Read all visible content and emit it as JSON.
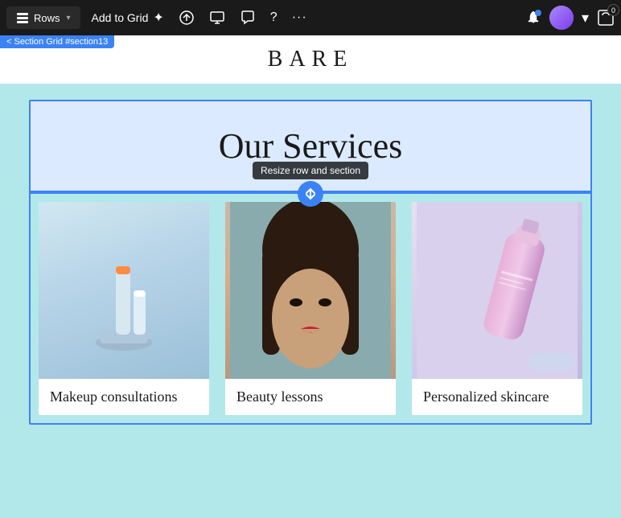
{
  "toolbar": {
    "rows_label": "Rows",
    "add_to_grid_label": "Add to Grid",
    "icons": {
      "sparkle": "✦",
      "move_up": "⬆",
      "desktop": "🖥",
      "comment": "💬",
      "help": "?",
      "more": "···"
    },
    "right_icons": {
      "bell": "🔔",
      "chevron": "▾",
      "cart_count": "0"
    }
  },
  "brand": {
    "name": "BARE"
  },
  "section_label": "< Section Grid #section13",
  "canvas": {
    "section_title": "Our Services",
    "resize_tooltip": "Resize row and section",
    "cards": [
      {
        "label": "Makeup consultations",
        "image_type": "makeup"
      },
      {
        "label": "Beauty lessons",
        "image_type": "beauty"
      },
      {
        "label": "Personalized skincare",
        "image_type": "skincare"
      }
    ]
  }
}
